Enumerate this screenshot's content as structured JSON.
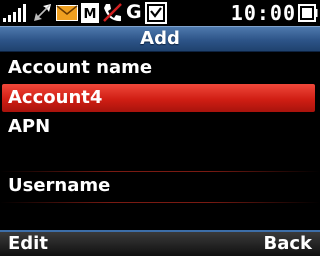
{
  "status_bar": {
    "time": "10:00",
    "network_letter": "G",
    "icons": [
      "signal-strength-icon",
      "data-transfer-icon",
      "envelope-icon",
      "mms-icon",
      "missed-call-icon",
      "network-icon",
      "voicemail-icon",
      "battery-icon"
    ]
  },
  "header": {
    "title": "Add"
  },
  "form": {
    "rows": [
      {
        "label": "Account name",
        "selected": false
      },
      {
        "label": "Account4",
        "selected": true
      },
      {
        "label": "APN",
        "selected": false
      },
      {
        "label": "",
        "selected": false
      },
      {
        "label": "Username",
        "selected": false
      }
    ]
  },
  "softkeys": {
    "left": "Edit",
    "right": "Back"
  },
  "colors": {
    "title_bar": "#2d5488",
    "selection": "#d01e14",
    "background": "#000000"
  }
}
